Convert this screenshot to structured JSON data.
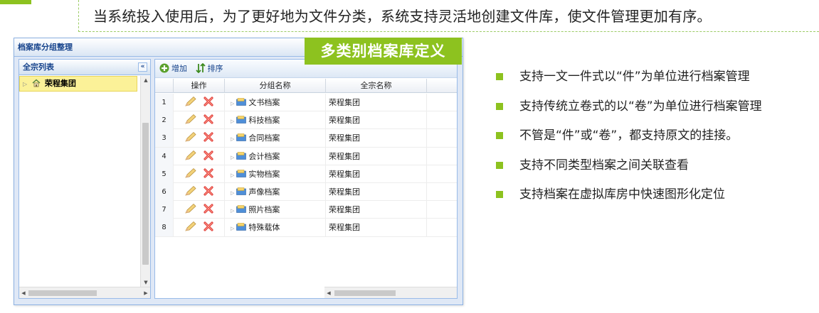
{
  "headline": "当系统投入使用后，为了更好地为文件分类，系统支持灵活地创建文件库，使文件管理更加有序。",
  "badge": "多类别档案库定义",
  "colors": {
    "accent": "#8dc21f",
    "panel_border": "#99bbe8",
    "title_text": "#15428b",
    "selected_row": "#fbf198"
  },
  "window": {
    "title": "档案库分组整理"
  },
  "left_panel": {
    "header": "全宗列表",
    "collapse_icon": "double-chevron-left-icon",
    "tree": [
      {
        "label": "荣程集团",
        "icon": "home-icon",
        "selected": true
      }
    ]
  },
  "toolbar": {
    "add_label": "增加",
    "sort_label": "排序"
  },
  "grid": {
    "columns": [
      "操作",
      "分组名称",
      "全宗名称"
    ],
    "rows": [
      {
        "num": "1",
        "name": "文书档案",
        "org": "荣程集团"
      },
      {
        "num": "2",
        "name": "科技档案",
        "org": "荣程集团"
      },
      {
        "num": "3",
        "name": "合同档案",
        "org": "荣程集团"
      },
      {
        "num": "4",
        "name": "会计档案",
        "org": "荣程集团"
      },
      {
        "num": "5",
        "name": "实物档案",
        "org": "荣程集团"
      },
      {
        "num": "6",
        "name": "声像档案",
        "org": "荣程集团"
      },
      {
        "num": "7",
        "name": "照片档案",
        "org": "荣程集团"
      },
      {
        "num": "8",
        "name": "特殊载体",
        "org": "荣程集团"
      }
    ]
  },
  "bullets": [
    "支持一文一件式以“件”为单位进行档案管理",
    "支持传统立卷式的以“卷”为单位进行档案管理",
    "不管是“件”或“卷”，都支持原文的挂接。",
    "支持不同类型档案之间关联查看",
    "支持档案在虚拟库房中快速图形化定位"
  ]
}
